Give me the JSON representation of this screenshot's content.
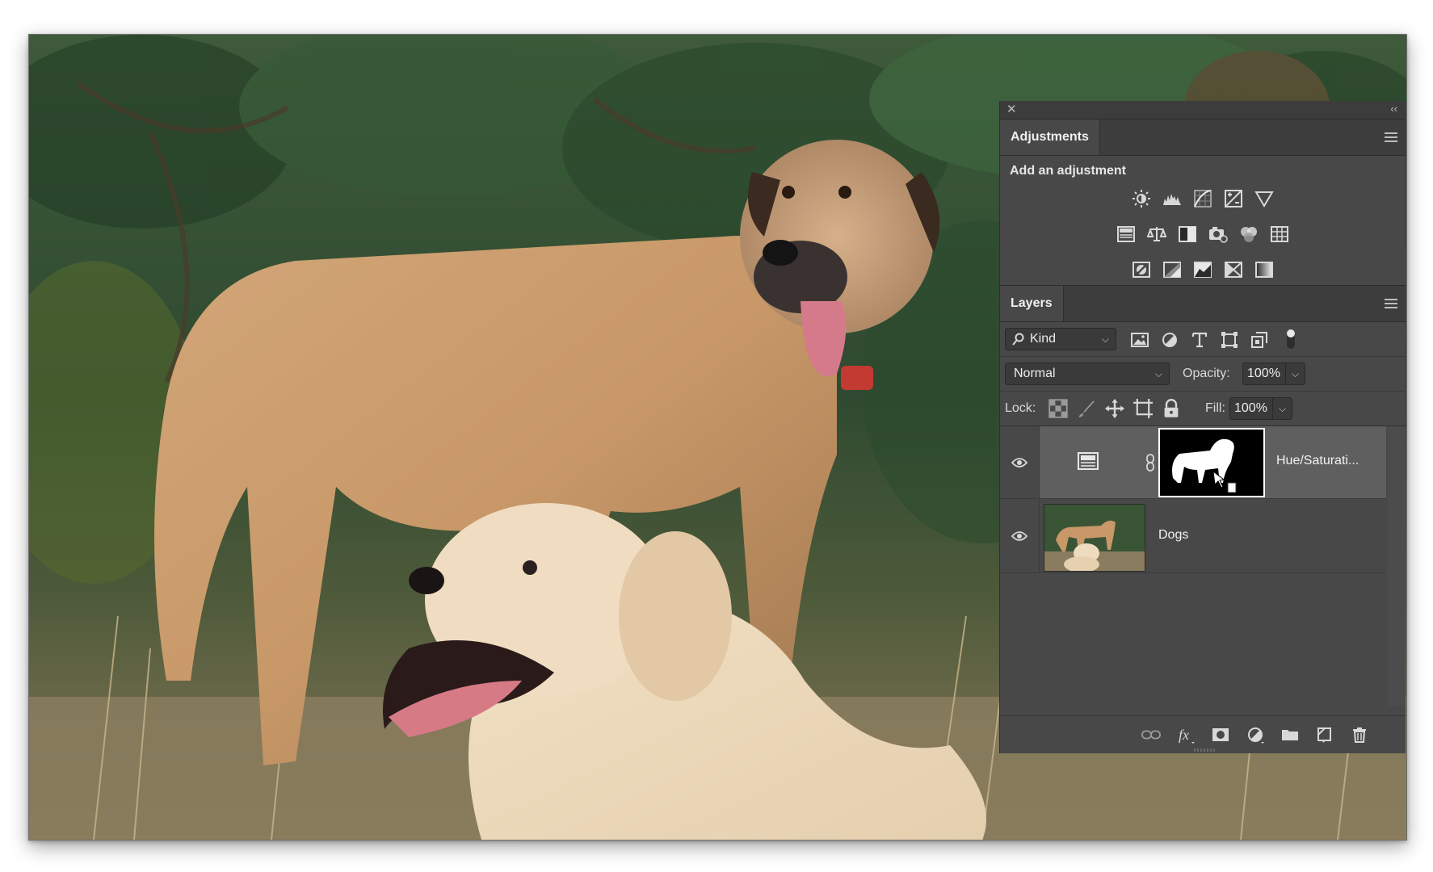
{
  "adjustments_panel": {
    "tab_label": "Adjustments",
    "section_title": "Add an adjustment",
    "row1_icons": [
      "brightness-contrast-icon",
      "levels-icon",
      "curves-icon",
      "exposure-icon",
      "vibrance-icon"
    ],
    "row2_icons": [
      "hue-saturation-icon",
      "color-balance-icon",
      "black-white-icon",
      "photo-filter-icon",
      "channel-mixer-icon",
      "color-lookup-icon"
    ],
    "row3_icons": [
      "invert-icon",
      "posterize-icon",
      "threshold-icon",
      "selective-color-icon",
      "gradient-map-icon"
    ]
  },
  "layers_panel": {
    "tab_label": "Layers",
    "filter_kind": "Kind",
    "blend_mode": "Normal",
    "opacity_label": "Opacity:",
    "opacity_value": "100%",
    "lock_label": "Lock:",
    "fill_label": "Fill:",
    "fill_value": "100%",
    "layers": [
      {
        "name": "Hue/Saturati...",
        "selected": true,
        "visible": true,
        "type": "adjustment"
      },
      {
        "name": "Dogs",
        "selected": false,
        "visible": true,
        "type": "pixel"
      }
    ],
    "footer_icons": [
      "link-layers-icon",
      "fx-icon",
      "add-mask-icon",
      "new-adjustment-icon",
      "new-group-icon",
      "new-layer-icon",
      "delete-layer-icon"
    ]
  },
  "colors": {
    "panel_bg": "#484848",
    "panel_dark": "#3d3d3d",
    "selected_layer": "#5f5f5f",
    "text": "#e3e3e3"
  }
}
